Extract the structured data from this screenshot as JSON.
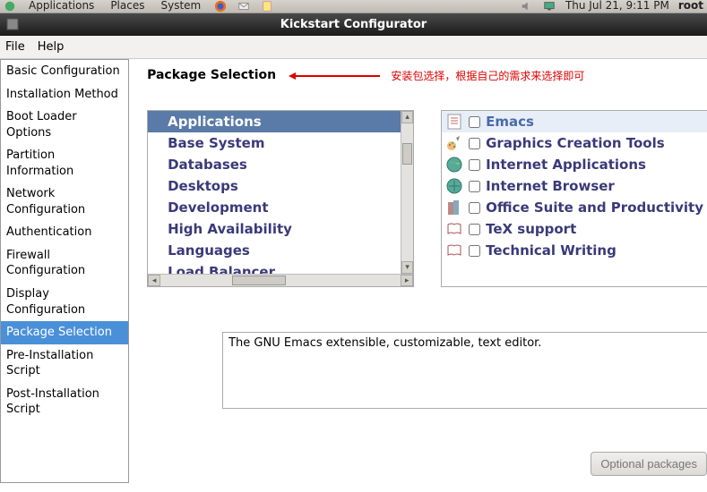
{
  "panel": {
    "menus": [
      "Applications",
      "Places",
      "System"
    ],
    "datetime": "Thu Jul 21,  9:11 PM",
    "user": "root"
  },
  "window": {
    "title": "Kickstart Configurator"
  },
  "menubar": [
    "File",
    "Help"
  ],
  "sidebar": {
    "items": [
      "Basic Configuration",
      "Installation Method",
      "Boot Loader Options",
      "Partition Information",
      "Network Configuration",
      "Authentication",
      "Firewall Configuration",
      "Display Configuration",
      "Package Selection",
      "Pre-Installation Script",
      "Post-Installation Script"
    ],
    "selected_index": 8
  },
  "section": {
    "title": "Package Selection",
    "annotation": "安装包选择，根据自己的需求来选择即可"
  },
  "groups": {
    "items": [
      "Applications",
      "Base System",
      "Databases",
      "Desktops",
      "Development",
      "High Availability",
      "Languages",
      "Load Balancer"
    ],
    "selected_index": 0
  },
  "packages": {
    "items": [
      {
        "label": "Emacs",
        "checked": false,
        "selected": true
      },
      {
        "label": "Graphics Creation Tools",
        "checked": false,
        "selected": false
      },
      {
        "label": "Internet Applications",
        "checked": false,
        "selected": false
      },
      {
        "label": "Internet Browser",
        "checked": false,
        "selected": false
      },
      {
        "label": "Office Suite and Productivity",
        "checked": false,
        "selected": false
      },
      {
        "label": "TeX support",
        "checked": false,
        "selected": false
      },
      {
        "label": "Technical Writing",
        "checked": false,
        "selected": false
      }
    ]
  },
  "description": "The GNU Emacs extensible, customizable, text editor.",
  "buttons": {
    "optional_packages": "Optional packages"
  }
}
